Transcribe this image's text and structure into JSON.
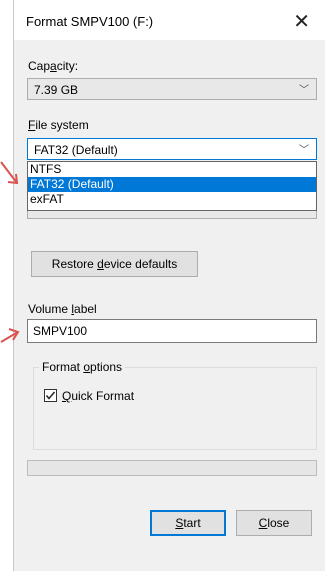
{
  "window": {
    "title": "Format SMPV100 (F:)",
    "close_icon": "close-icon"
  },
  "capacity": {
    "label_pre": "Cap",
    "label_key": "a",
    "label_post": "city:",
    "value": "7.39 GB"
  },
  "file_system": {
    "label_key": "F",
    "label_post": "ile system",
    "value": "FAT32 (Default)",
    "options": [
      "NTFS",
      "FAT32 (Default)",
      "exFAT"
    ],
    "selected_index": 1
  },
  "restore_button": {
    "pre": "Restore ",
    "key": "d",
    "post": "evice defaults"
  },
  "volume_label": {
    "label_pre": "Volume ",
    "label_key": "l",
    "label_post": "abel",
    "value": "SMPV100"
  },
  "format_options": {
    "title_pre": "Format ",
    "title_key": "o",
    "title_post": "ptions",
    "quick_format": {
      "key": "Q",
      "post": "uick Format",
      "checked": true
    }
  },
  "progress": {
    "fraction": 0
  },
  "buttons": {
    "start": {
      "key": "S",
      "post": "tart"
    },
    "close": {
      "key": "C",
      "post": "lose"
    }
  },
  "colors": {
    "accent": "#0078d7",
    "annotation_arrow": "#d9534f",
    "dialog_bg": "#f0f0f0"
  }
}
